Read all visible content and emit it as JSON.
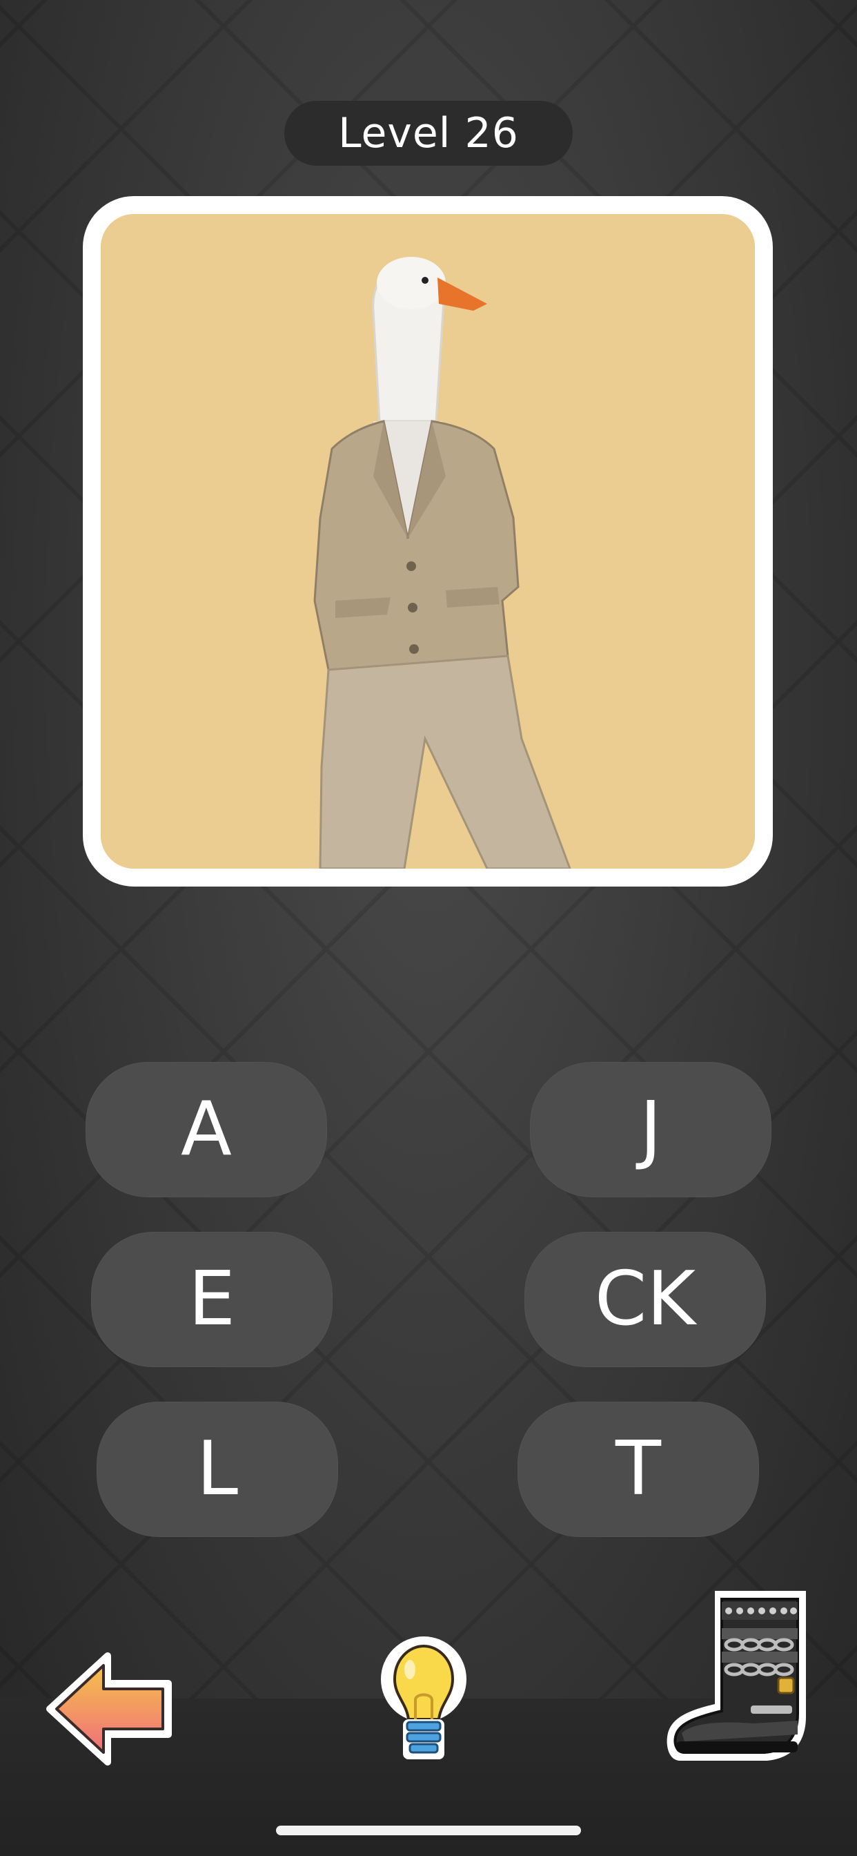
{
  "header": {
    "level_label": "Level 26"
  },
  "puzzle": {
    "image_subject": "goose-head-person-in-beige-suit",
    "card_background_color": "#ebcd92"
  },
  "answers": {
    "options": [
      "A",
      "J",
      "E",
      "CK",
      "L",
      "T"
    ]
  },
  "toolbar": {
    "back_icon": "left-arrow-icon",
    "hint_icon": "lightbulb-icon",
    "shop_icon": "spiked-boot-icon"
  },
  "colors": {
    "background": "#3a3a3a",
    "button": "#4d4d4d",
    "level_pill": "#2c2c2c",
    "arrow_top": "#f6c14a",
    "arrow_bottom": "#ef6f7a"
  }
}
